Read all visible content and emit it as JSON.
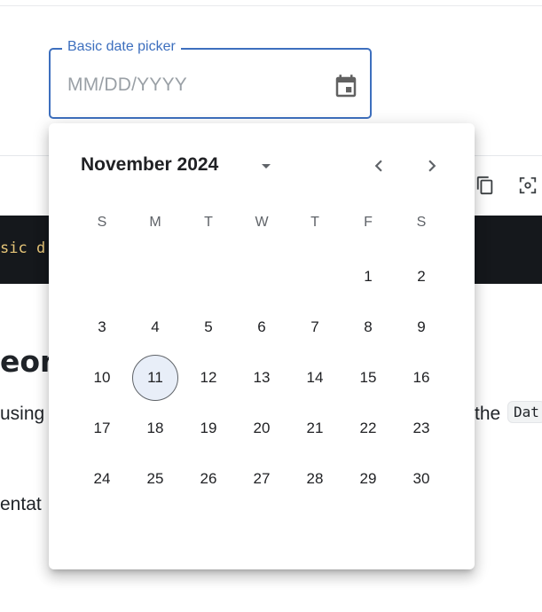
{
  "field": {
    "label": "Basic date picker",
    "placeholder": "MM/DD/YYYY",
    "calendar_icon": "calendar-icon"
  },
  "background": {
    "code_snippet": "sic d",
    "heading_fragment": "eom",
    "paragraph_left": "using",
    "paragraph_right": "the",
    "code_chip": "Dat",
    "paragraph2": "entat",
    "toolbar_icons": [
      "copy-icon",
      "fullscreen-icon"
    ]
  },
  "calendar": {
    "month_year": "November 2024",
    "weekdays": [
      "S",
      "M",
      "T",
      "W",
      "T",
      "F",
      "S"
    ],
    "first_weekday_index": 5,
    "days_in_month": 30,
    "today": 11,
    "icons": {
      "dropdown": "arrow-drop-down-icon",
      "prev": "chevron-left-icon",
      "next": "chevron-right-icon"
    },
    "colors": {
      "accent": "#3d6fbe",
      "today_fill": "#e8eef8"
    }
  }
}
